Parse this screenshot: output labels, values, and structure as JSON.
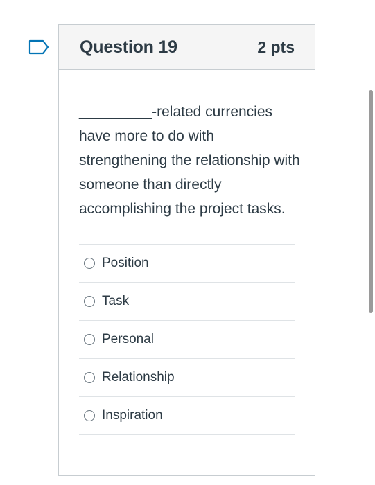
{
  "question": {
    "title": "Question 19",
    "points": "2 pts",
    "text": "_________-related currencies have more to do with strengthening the relationship with someone than directly accomplishing the project tasks.",
    "options": [
      {
        "label": "Position"
      },
      {
        "label": "Task"
      },
      {
        "label": "Personal"
      },
      {
        "label": "Relationship"
      },
      {
        "label": "Inspiration"
      }
    ]
  },
  "colors": {
    "text": "#2d3b45",
    "header_bg": "#f5f5f5",
    "border": "#c7cdd1",
    "flag": "#0374b5",
    "scrollbar": "#9a9a9a"
  },
  "icons": {
    "flag": "bookmark-flag-icon",
    "radio": "radio-button-icon"
  }
}
